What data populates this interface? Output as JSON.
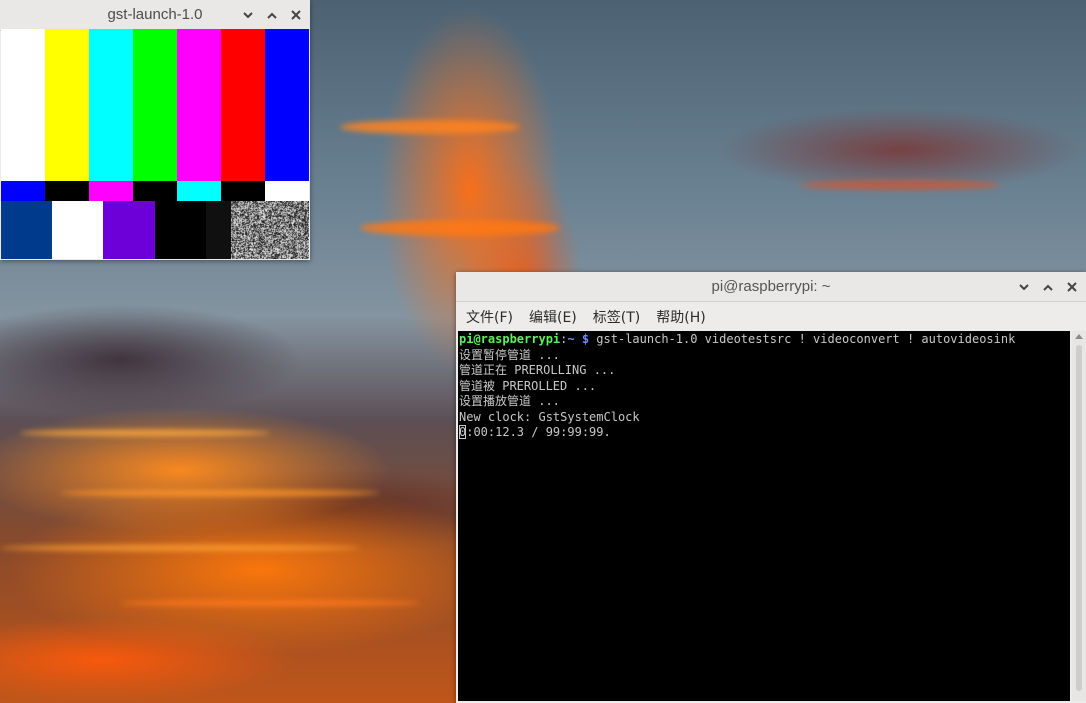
{
  "video_window": {
    "title": "gst-launch-1.0",
    "controls": [
      "minimize",
      "maximize",
      "close"
    ],
    "pattern": {
      "top_bars": [
        "#ffffff",
        "#ffff00",
        "#00ffff",
        "#00ff00",
        "#ff00ff",
        "#ff0000",
        "#0000ff"
      ],
      "middle_bars": [
        "#0000ff",
        "#000000",
        "#ff00ff",
        "#000000",
        "#00ffff",
        "#000000",
        "#ffffff"
      ],
      "bottom_blocks": [
        "#003a8c",
        "#ffffff",
        "#6d00d9",
        "#000000",
        "#000000",
        "#101010"
      ]
    }
  },
  "terminal_window": {
    "title": "pi@raspberrypi: ~",
    "menu": [
      "文件(F)",
      "编辑(E)",
      "标签(T)",
      "帮助(H)"
    ],
    "prompt": {
      "user": "pi@raspberrypi",
      "separator": ":",
      "path": "~ $",
      "command": " gst-launch-1.0 videotestsrc ! videoconvert ! autovideosink"
    },
    "output_lines": [
      "设置暂停管道 ...",
      "管道正在 PREROLLING ...",
      "管道被 PREROLLED ...",
      "设置播放管道 ...",
      "New clock: GstSystemClock"
    ],
    "status_line": {
      "cursor_char": "0",
      "rest": ":00:12.3 / 99:99:99."
    }
  },
  "colors": {
    "prompt_user": "#5cf25c",
    "prompt_path": "#6e8cff",
    "terminal_bg": "#000000",
    "terminal_fg": "#c8c8c8"
  }
}
